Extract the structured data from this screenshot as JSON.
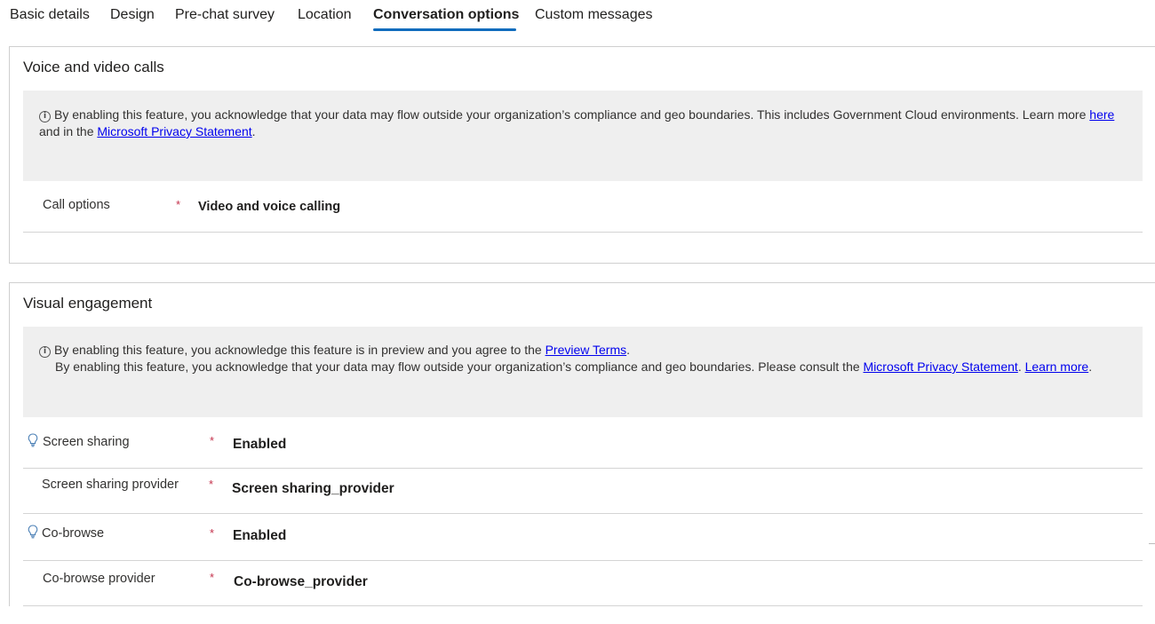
{
  "tabs": [
    {
      "label": "Basic details"
    },
    {
      "label": "Design"
    },
    {
      "label": "Pre-chat survey"
    },
    {
      "label": "Location"
    },
    {
      "label": "Conversation options",
      "active": true
    },
    {
      "label": "Custom messages"
    }
  ],
  "voice": {
    "title": "Voice and video calls",
    "notice": {
      "text1": "By enabling this feature, you acknowledge that your data may flow outside your organization’s compliance and geo boundaries. This includes Government Cloud environments. Learn more",
      "link_here": "here",
      "text2": " and in the ",
      "link_privacy": "Microsoft Privacy Statement",
      "text3": "."
    },
    "call_options": {
      "label": "Call options",
      "required": "*",
      "value": "Video and voice calling"
    }
  },
  "visual": {
    "title": "Visual engagement",
    "notice": {
      "line1_text": "By enabling this feature, you acknowledge this feature is in preview and you agree to the ",
      "line1_link": "Preview Terms",
      "line1_end": ".",
      "line2_text": "By enabling this feature, you acknowledge that your data may flow outside your organization’s compliance and geo boundaries. Please consult the ",
      "line2_link_privacy": "Microsoft Privacy Statement",
      "line2_sep": ". ",
      "line2_link_learn": "Learn more",
      "line2_end": "."
    },
    "rows": [
      {
        "label": "Screen sharing",
        "required": "*",
        "value": "Enabled",
        "icon": "lightbulb-icon"
      },
      {
        "label": "Screen sharing provider",
        "required": "*",
        "value": "Screen sharing_provider"
      },
      {
        "label": "Co-browse",
        "required": "*",
        "value": "Enabled",
        "icon": "lightbulb-icon"
      },
      {
        "label": "Co-browse provider",
        "required": "*",
        "value": "Co-browse_provider"
      }
    ]
  },
  "colors": {
    "accent": "#0f6cbd",
    "required": "#c4314b",
    "link": "#0000ee",
    "notice_bg": "#efefef"
  }
}
